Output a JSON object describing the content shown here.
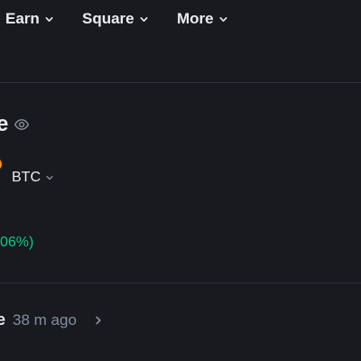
{
  "topnav": {
    "items": [
      {
        "label": "Earn",
        "icon": "chevron-down-icon"
      },
      {
        "label": "Square",
        "icon": "chevron-down-icon"
      },
      {
        "label": "More",
        "icon": "chevron-down-icon"
      }
    ]
  },
  "balance": {
    "title_fragment": "e",
    "visibility_icon": "eye-icon",
    "currency": "BTC",
    "currency_icon": "chevron-down-icon",
    "coin_icon": "bitcoin-icon",
    "coin_color": "#f7931a",
    "pnl_fragment": "06%)",
    "pnl_color": "#0ecb81"
  },
  "activity": {
    "label_fragment": "e",
    "time": "38 m ago",
    "icon": "chevron-right-icon"
  },
  "colors": {
    "background": "#181a20",
    "text": "#eaecef",
    "muted": "#848e9c",
    "divider": "#2b3139"
  }
}
